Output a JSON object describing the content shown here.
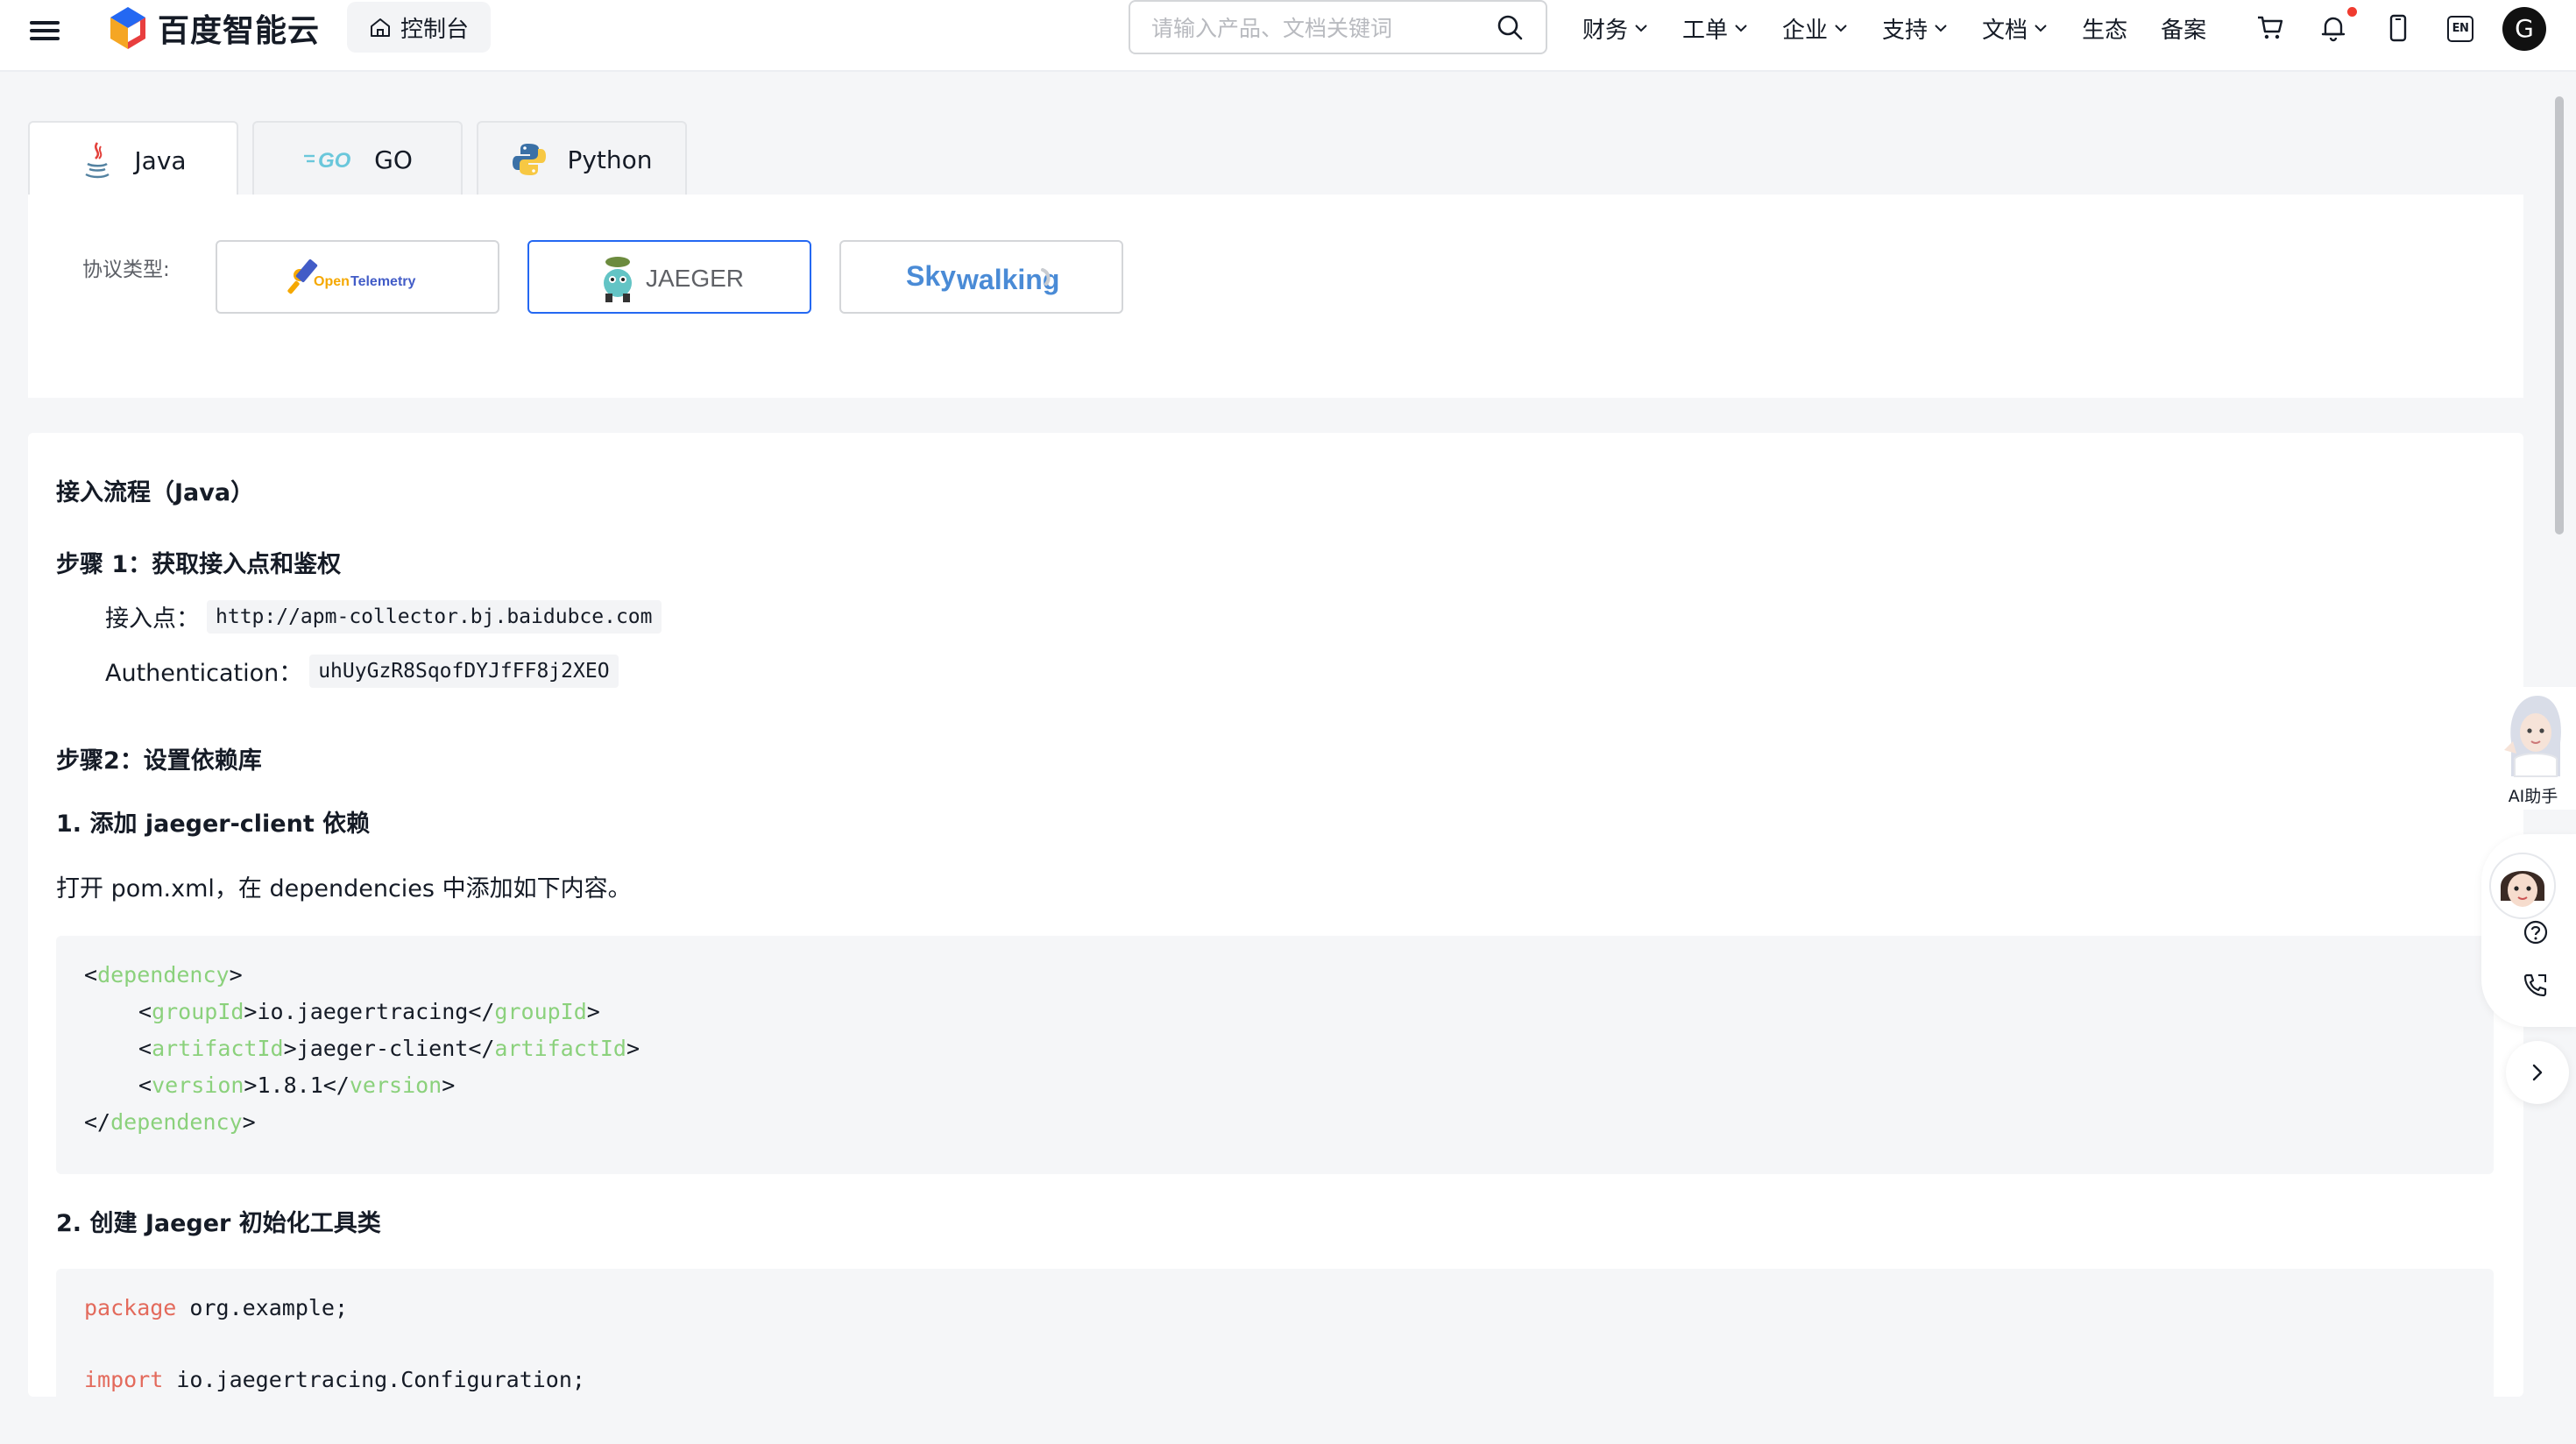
{
  "header": {
    "logo_text": "百度智能云",
    "console_label": "控制台",
    "search_placeholder": "请输入产品、文档关键词",
    "nav": [
      {
        "label": "财务",
        "dropdown": true
      },
      {
        "label": "工单",
        "dropdown": true
      },
      {
        "label": "企业",
        "dropdown": true
      },
      {
        "label": "支持",
        "dropdown": true
      },
      {
        "label": "文档",
        "dropdown": true
      },
      {
        "label": "生态",
        "dropdown": false
      },
      {
        "label": "备案",
        "dropdown": false
      }
    ],
    "lang_badge": "EN",
    "avatar_initial": "G",
    "icons": [
      "menu-icon",
      "home-icon",
      "search-icon",
      "cart-icon",
      "bell-icon",
      "phone-icon",
      "language-icon"
    ]
  },
  "lang_tabs": {
    "active": "Java",
    "items": [
      {
        "label": "Java",
        "icon": "java-icon"
      },
      {
        "label": "GO",
        "icon": "go-icon"
      },
      {
        "label": "Python",
        "icon": "python-icon"
      }
    ]
  },
  "protocol": {
    "label": "协议类型:",
    "active": "JAEGER",
    "options": [
      {
        "name": "OpenTelemetry",
        "logo_text_a": "Open",
        "logo_text_b": "Telemetry"
      },
      {
        "name": "JAEGER",
        "logo_text": "JAEGER"
      },
      {
        "name": "Skywalking",
        "logo_text_a": "Sky",
        "logo_text_b": "walking"
      }
    ]
  },
  "doc": {
    "title": "接入流程（Java）",
    "step1": "步骤 1：获取接入点和鉴权",
    "endpoint_label": "接入点：",
    "endpoint_value": "http://apm-collector.bj.baidubce.com",
    "auth_label": "Authentication：",
    "auth_value": "uhUyGzR8SqofDYJfFF8j2XEO",
    "step2": "步骤2：设置依赖库",
    "sub1": "1. 添加 jaeger-client 依赖",
    "sub1_desc": "打开 pom.xml，在 dependencies 中添加如下内容。",
    "code1": {
      "l1_tag": "dependency",
      "l2_tag": "groupId",
      "l2_val": "io.jaegertracing",
      "l3_tag": "artifactId",
      "l3_val": "jaeger-client",
      "l4_tag": "version",
      "l4_val": "1.8.1",
      "l5_tag": "dependency"
    },
    "sub2": "2. 创建 Jaeger 初始化工具类",
    "code2": {
      "l1_kw": "package",
      "l1_rest": " org.example;",
      "l3_kw": "import",
      "l3_rest": " io.jaegertracing.Configuration;"
    }
  },
  "rail": {
    "ai_label": "AI助手",
    "icons": [
      "avatar-icon",
      "help-icon",
      "phone-call-icon",
      "chevron-right-icon"
    ]
  },
  "colors": {
    "accent": "#2468f2",
    "code_tag": "#8bd17c",
    "code_keyword": "#e36a5c",
    "notification_dot": "#f03b2f"
  }
}
